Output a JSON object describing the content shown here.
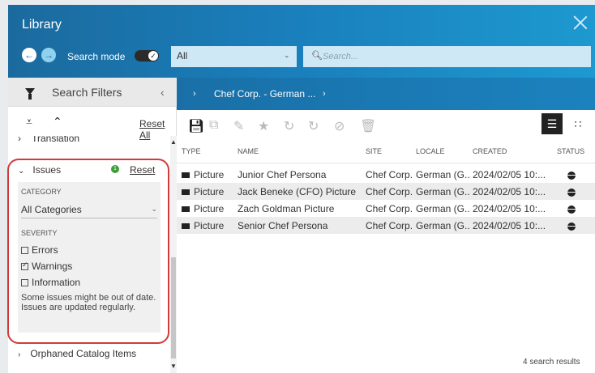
{
  "window": {
    "title": "Library"
  },
  "header": {
    "search_mode_label": "Search mode",
    "type_select_value": "All",
    "search_placeholder": "Search..."
  },
  "filters": {
    "title": "Search Filters",
    "reset_all": "Reset All",
    "translation_label": "Translation",
    "issues": {
      "label": "Issues",
      "badge_count": "1",
      "reset": "Reset",
      "category_label": "CATEGORY",
      "category_value": "All Categories",
      "severity_label": "SEVERITY",
      "options": [
        {
          "label": "Errors",
          "checked": false
        },
        {
          "label": "Warnings",
          "checked": true
        },
        {
          "label": "Information",
          "checked": false
        }
      ],
      "note": "Some issues might be out of date. Issues are updated regularly."
    },
    "orphaned_label": "Orphaned Catalog Items"
  },
  "breadcrumb": {
    "item": "Chef Corp. - German ..."
  },
  "table": {
    "headers": [
      "TYPE",
      "NAME",
      "SITE",
      "LOCALE",
      "CREATED",
      "STATUS"
    ],
    "rows": [
      {
        "type": "Picture",
        "name": "Junior Chef Persona",
        "site": "Chef Corp.",
        "locale": "German (G...",
        "created": "2024/02/05 10:..."
      },
      {
        "type": "Picture",
        "name": "Jack Beneke (CFO) Picture",
        "site": "Chef Corp.",
        "locale": "German (G...",
        "created": "2024/02/05 10:..."
      },
      {
        "type": "Picture",
        "name": "Zach Goldman Picture",
        "site": "Chef Corp.",
        "locale": "German (G...",
        "created": "2024/02/05 10:..."
      },
      {
        "type": "Picture",
        "name": "Senior Chef Persona",
        "site": "Chef Corp.",
        "locale": "German (G...",
        "created": "2024/02/05 10:..."
      }
    ]
  },
  "results_text": "4 search results",
  "colors": {
    "header_blue": "#1a80bd",
    "highlight_red": "#d23a3a",
    "badge_green": "#3d9d3d"
  }
}
